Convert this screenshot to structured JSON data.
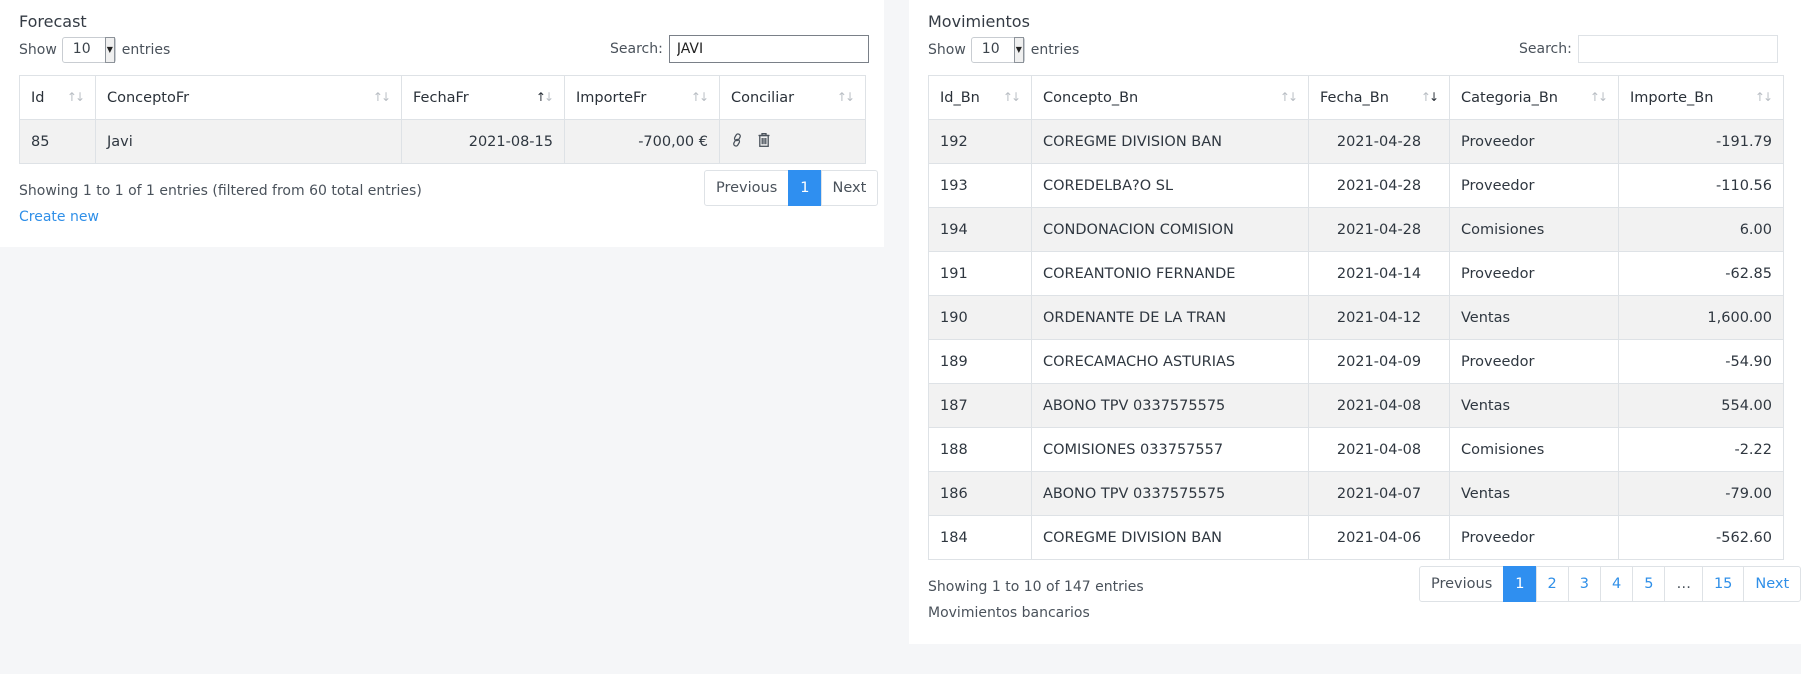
{
  "forecast": {
    "title": "Forecast",
    "length": {
      "show": "Show",
      "value": "10",
      "entries": "entries"
    },
    "search": {
      "label": "Search:",
      "value": "JAVI",
      "placeholder": ""
    },
    "columns": [
      "Id",
      "ConceptoFr",
      "FechaFr",
      "ImporteFr",
      "Conciliar"
    ],
    "rows": [
      {
        "id": "85",
        "concepto": "Javi",
        "fecha": "2021-08-15",
        "importe": "-700,00 €"
      }
    ],
    "info": "Showing 1 to 1 of 1 entries (filtered from 60 total entries)",
    "create_new": "Create new",
    "pagination": {
      "previous": "Previous",
      "pages": [
        "1"
      ],
      "next": "Next"
    }
  },
  "movimientos": {
    "title": "Movimientos",
    "length": {
      "show": "Show",
      "value": "10",
      "entries": "entries"
    },
    "search": {
      "label": "Search:",
      "value": "",
      "placeholder": ""
    },
    "columns": [
      "Id_Bn",
      "Concepto_Bn",
      "Fecha_Bn",
      "Categoria_Bn",
      "Importe_Bn"
    ],
    "rows": [
      {
        "id": "192",
        "concepto": "COREGME DIVISION BAN",
        "fecha": "2021-04-28",
        "categoria": "Proveedor",
        "importe": "-191.79"
      },
      {
        "id": "193",
        "concepto": "COREDELBA?O SL",
        "fecha": "2021-04-28",
        "categoria": "Proveedor",
        "importe": "-110.56"
      },
      {
        "id": "194",
        "concepto": "CONDONACION COMISION",
        "fecha": "2021-04-28",
        "categoria": "Comisiones",
        "importe": "6.00"
      },
      {
        "id": "191",
        "concepto": "COREANTONIO FERNANDE",
        "fecha": "2021-04-14",
        "categoria": "Proveedor",
        "importe": "-62.85"
      },
      {
        "id": "190",
        "concepto": "ORDENANTE DE LA TRAN",
        "fecha": "2021-04-12",
        "categoria": "Ventas",
        "importe": "1,600.00"
      },
      {
        "id": "189",
        "concepto": "CORECAMACHO ASTURIAS",
        "fecha": "2021-04-09",
        "categoria": "Proveedor",
        "importe": "-54.90"
      },
      {
        "id": "187",
        "concepto": "ABONO TPV 0337575575",
        "fecha": "2021-04-08",
        "categoria": "Ventas",
        "importe": "554.00"
      },
      {
        "id": "188",
        "concepto": "COMISIONES 033757557",
        "fecha": "2021-04-08",
        "categoria": "Comisiones",
        "importe": "-2.22"
      },
      {
        "id": "186",
        "concepto": "ABONO TPV 0337575575",
        "fecha": "2021-04-07",
        "categoria": "Ventas",
        "importe": "-79.00"
      },
      {
        "id": "184",
        "concepto": "COREGME DIVISION BAN",
        "fecha": "2021-04-06",
        "categoria": "Proveedor",
        "importe": "-562.60"
      }
    ],
    "info": "Showing 1 to 10 of 147 entries",
    "footer": "Movimientos bancarios",
    "pagination": {
      "previous": "Previous",
      "pages": [
        "1",
        "2",
        "3",
        "4",
        "5",
        "…",
        "15"
      ],
      "next": "Next"
    }
  },
  "icons": {
    "link": "link-icon",
    "delete": "trash-icon"
  },
  "colors": {
    "accent": "#2f8ff0",
    "link": "#2f8fe8",
    "stripe": "#f2f2f2",
    "border": "#dee2e6"
  }
}
